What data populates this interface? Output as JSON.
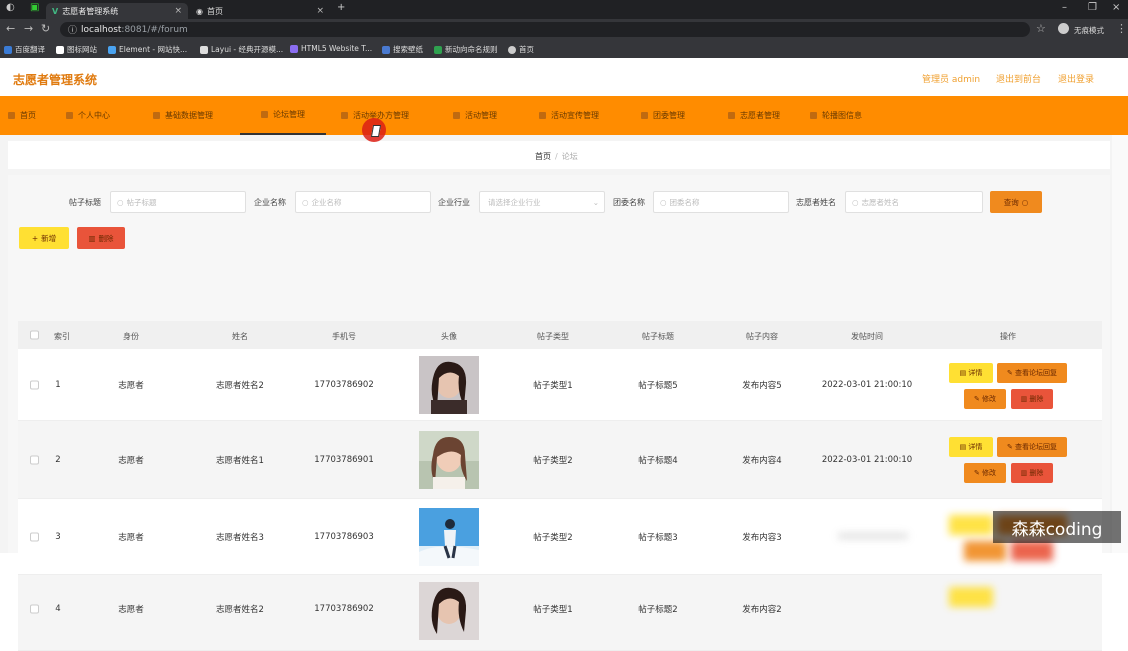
{
  "browser": {
    "tabs": [
      {
        "label": "志愿者管理系统",
        "active": true
      },
      {
        "label": "首页",
        "active": false
      }
    ],
    "new_tab": "+",
    "url_host": "localhost",
    "url_path": ":8081/#/forum",
    "profile_label": "无痕模式",
    "bookmarks": [
      "百度翻译",
      "图标网站",
      "Element - 网站快...",
      "Layui - 经典开源模...",
      "HTML5 Website T...",
      "搜索壁纸",
      "新动向命名规则",
      "首页"
    ]
  },
  "header": {
    "brand": "志愿者管理系统",
    "admin_label": "管理员 admin",
    "back_label": "退出到前台",
    "logout_label": "退出登录"
  },
  "menu": [
    {
      "label": "首页"
    },
    {
      "label": "个人中心"
    },
    {
      "label": "基础数据管理"
    },
    {
      "label": "论坛管理",
      "active": true
    },
    {
      "label": "活动举办方管理"
    },
    {
      "label": "活动管理"
    },
    {
      "label": "活动宣传管理"
    },
    {
      "label": "团委管理"
    },
    {
      "label": "志愿者管理"
    },
    {
      "label": "轮播图信息"
    }
  ],
  "breadcrumb": {
    "home": "首页",
    "sep": "/",
    "current": "论坛"
  },
  "filters": {
    "post_title_label": "帖子标题",
    "post_title_ph": "帖子标题",
    "company_label": "企业名称",
    "company_ph": "企业名称",
    "industry_label": "企业行业",
    "industry_ph": "请选择企业行业",
    "league_label": "团委名称",
    "league_ph": "团委名称",
    "volunteer_label": "志愿者姓名",
    "volunteer_ph": "志愿者姓名",
    "search_button": "查询"
  },
  "actions": {
    "add": "新增",
    "delete": "删除"
  },
  "table": {
    "headers": [
      "索引",
      "身份",
      "姓名",
      "手机号",
      "头像",
      "帖子类型",
      "帖子标题",
      "帖子内容",
      "发帖时间",
      "操作"
    ],
    "row_actions": {
      "detail": "详情",
      "view_replies": "查看论坛回复",
      "edit": "修改",
      "delete": "删除"
    },
    "rows": [
      {
        "index": "1",
        "identity": "志愿者",
        "name": "志愿者姓名2",
        "phone": "17703786902",
        "type": "帖子类型1",
        "title": "帖子标题5",
        "content": "发布内容5",
        "time": "2022-03-01 21:00:10"
      },
      {
        "index": "2",
        "identity": "志愿者",
        "name": "志愿者姓名1",
        "phone": "17703786901",
        "type": "帖子类型2",
        "title": "帖子标题4",
        "content": "发布内容4",
        "time": "2022-03-01 21:00:10"
      },
      {
        "index": "3",
        "identity": "志愿者",
        "name": "志愿者姓名3",
        "phone": "17703786903",
        "type": "帖子类型2",
        "title": "帖子标题3",
        "content": "发布内容3",
        "time": ""
      },
      {
        "index": "4",
        "identity": "志愿者",
        "name": "志愿者姓名2",
        "phone": "17703786902",
        "type": "帖子类型1",
        "title": "帖子标题2",
        "content": "发布内容2",
        "time": ""
      }
    ]
  },
  "watermark": "森森coding",
  "colors": {
    "accent": "#ff8c00",
    "brand": "#e07b10",
    "yellow_button": "#ffe033",
    "orange_button": "#f08a1e",
    "red_button": "#e9543a"
  }
}
